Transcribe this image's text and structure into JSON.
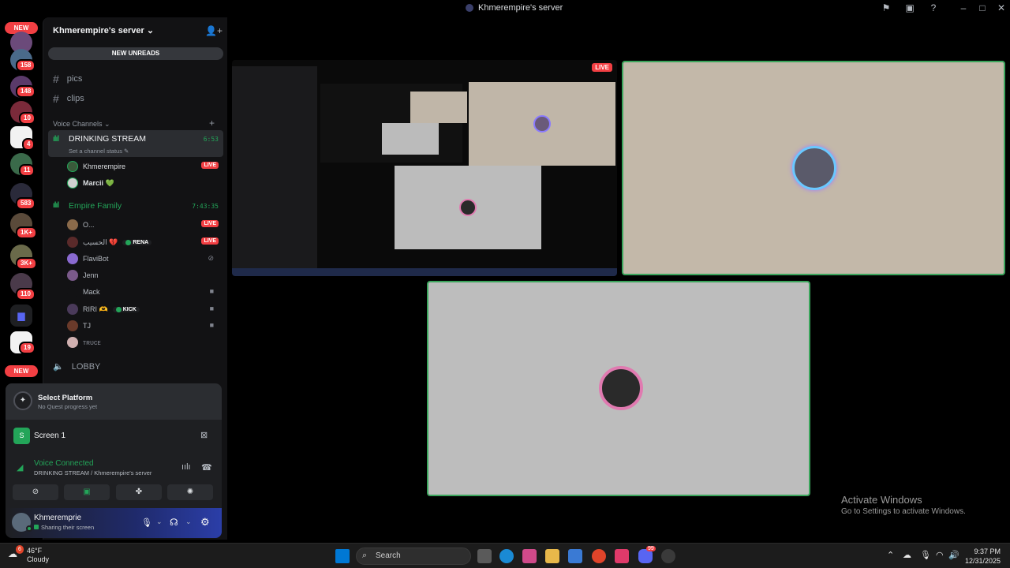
{
  "window": {
    "title": "Khmerempire's server"
  },
  "rail": {
    "new_top": "NEW",
    "new_bottom": "NEW",
    "badges": [
      "158",
      "148",
      "10",
      "4",
      "11",
      "583",
      "1K+",
      "3K+",
      "110",
      "19"
    ]
  },
  "sidebar": {
    "server_name": "Khmerempire's server",
    "new_unreads": "NEW UNREADS",
    "text_channels": [
      "pics",
      "clips"
    ],
    "voice_category": "Voice Channels",
    "drinking": {
      "name": "DRINKING STREAM",
      "timer": "6:53",
      "status": "Set a channel status",
      "users": [
        {
          "name": "Khmerempire",
          "badge": "LIVE"
        },
        {
          "name": "Marcii 💚",
          "badge": ""
        }
      ]
    },
    "empire": {
      "name": "Empire Family",
      "timer": "7:43:35",
      "users": [
        {
          "name": "O...",
          "badge": "LIVE"
        },
        {
          "name": "الحسيب 💔",
          "tag": "RENA",
          "badge": "LIVE"
        },
        {
          "name": "FlaviBot",
          "badge": ""
        },
        {
          "name": "Jenn",
          "badge": ""
        },
        {
          "name": "Mack",
          "badge": ""
        },
        {
          "name": "RIRI 🫶",
          "tag": "KICK",
          "badge": ""
        },
        {
          "name": "TJ",
          "badge": ""
        },
        {
          "name": "ᴛʀᴜᴄᴇ",
          "badge": ""
        }
      ]
    },
    "lobby": "LOBBY"
  },
  "quest": {
    "title": "Select Platform",
    "subtitle": "No Quest progress yet"
  },
  "screen_share": {
    "label": "Screen 1"
  },
  "voice": {
    "status": "Voice Connected",
    "location": "DRINKING STREAM / Khmerempire's server"
  },
  "user": {
    "name": "Khmeremprie",
    "status": "Sharing their screen"
  },
  "stream": {
    "live_badge": "LIVE"
  },
  "watermark": {
    "line1": "Activate Windows",
    "line2": "Go to Settings to activate Windows."
  },
  "taskbar": {
    "weather_temp": "46°F",
    "weather_desc": "Cloudy",
    "weather_badge": "6",
    "search_placeholder": "Search",
    "discord_badge": "99",
    "time": "9:37 PM",
    "date": "12/31/2025"
  },
  "colors": {
    "accent_green": "#23a559",
    "live_red": "#f23f43",
    "blurple": "#5865f2"
  }
}
